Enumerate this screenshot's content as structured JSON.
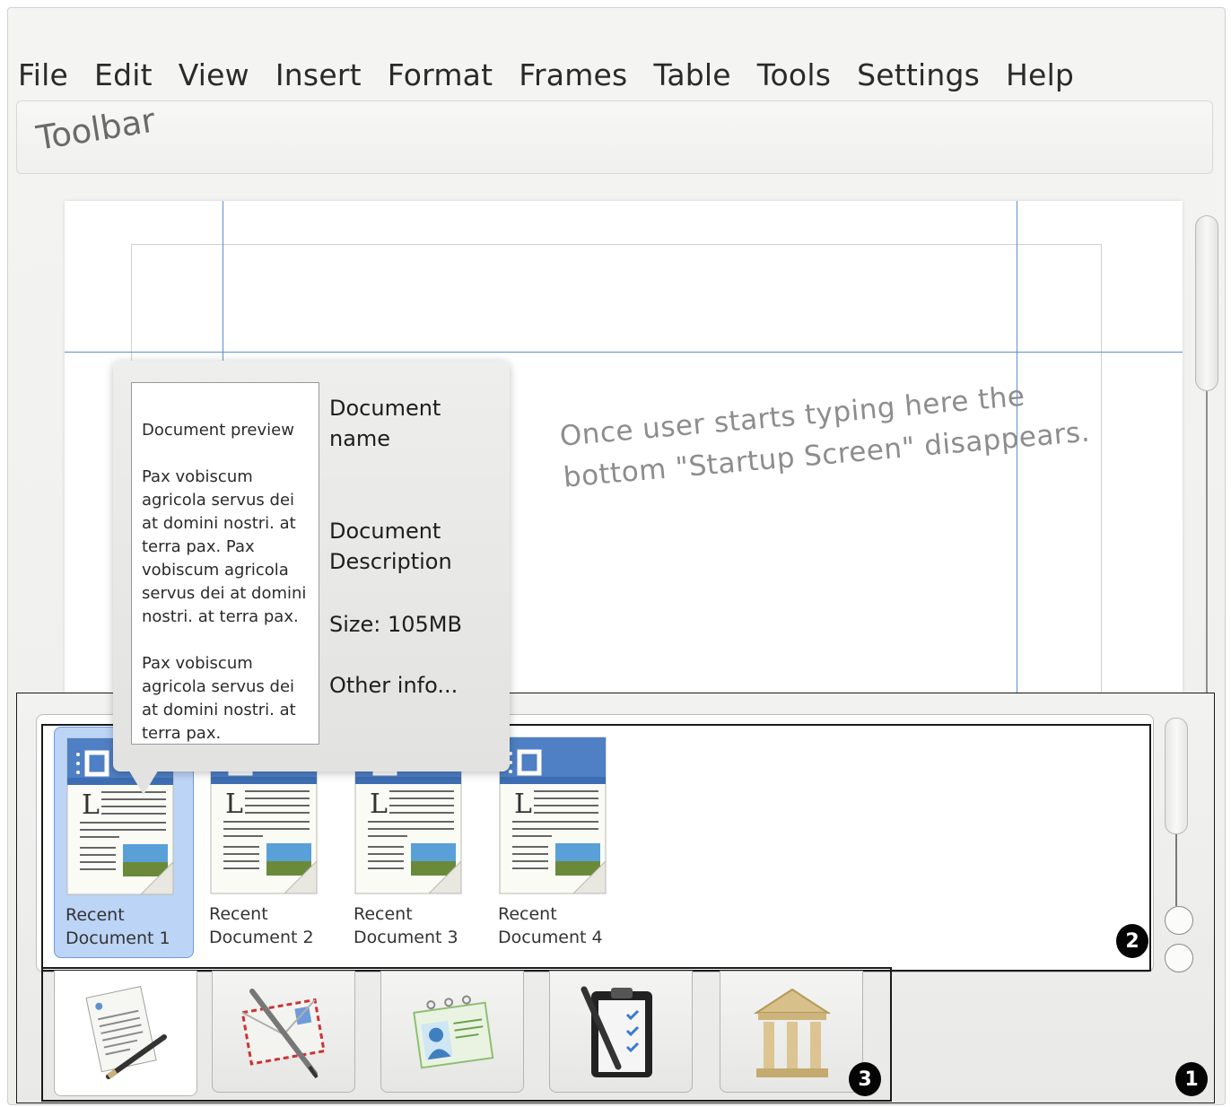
{
  "menubar": {
    "items": [
      "File",
      "Edit",
      "View",
      "Insert",
      "Format",
      "Frames",
      "Table",
      "Tools",
      "Settings",
      "Help"
    ]
  },
  "toolbar": {
    "label": "Toolbar"
  },
  "editor": {
    "typing_note": "Once user starts typing here the bottom \"Startup Screen\" disappears."
  },
  "tooltip": {
    "preview_title": "Document preview",
    "preview_paragraphs": [
      "Pax vobiscum agricola servus dei at domini nostri. at terra pax. Pax vobiscum agricola servus dei at domini nostri. at terra pax.",
      "Pax vobiscum agricola servus dei at domini nostri. at terra pax."
    ],
    "document_name": "Document name",
    "document_description": "Document Description",
    "size": "Size: 105MB",
    "other_info": "Other info..."
  },
  "recent_documents": [
    {
      "label": "Recent Document 1",
      "line1": "Recent",
      "line2": "Document 1",
      "selected": true
    },
    {
      "label": "Recent Document 2",
      "line1": "Recent",
      "line2": "Document 2",
      "selected": false
    },
    {
      "label": "Recent Document 3",
      "line1": "Recent",
      "line2": "Document 3",
      "selected": false
    },
    {
      "label": "Recent Document 4",
      "line1": "Recent",
      "line2": "Document 4",
      "selected": false
    }
  ],
  "template_tabs": [
    {
      "icon": "letter-document-icon",
      "active": true
    },
    {
      "icon": "mail-envelope-pen-icon",
      "active": false
    },
    {
      "icon": "contact-card-icon",
      "active": false
    },
    {
      "icon": "checklist-clipboard-icon",
      "active": false
    },
    {
      "icon": "classical-building-icon",
      "active": false
    }
  ],
  "badges": {
    "startup_screen": "1",
    "recent_panel": "2",
    "tabs": "3"
  },
  "colors": {
    "accent_selected": "#bcd4f6",
    "guide_line": "#5f8ed0"
  }
}
